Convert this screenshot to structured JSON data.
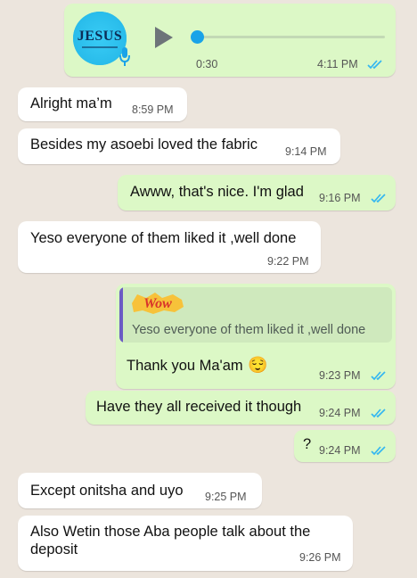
{
  "colors": {
    "chat_background": "#ece5dd",
    "incoming_bubble": "#ffffff",
    "outgoing_bubble": "#dcf8c6",
    "read_ticks": "#34b7f1",
    "voice_accent": "#1aa3e8",
    "quote_bar": "#6b5bc4"
  },
  "voice_note": {
    "avatar_text": "JESUS",
    "duration": "0:30",
    "time": "4:11 PM",
    "progress": 0,
    "play_icon": "play-icon",
    "mic_icon": "mic-icon"
  },
  "messages": [
    {
      "direction": "in",
      "text": "Alright ma’m",
      "time": "8:59 PM"
    },
    {
      "direction": "in",
      "text": "Besides my asoebi loved the fabric",
      "time": "9:14 PM"
    },
    {
      "direction": "out",
      "text": "Awww, that's nice. I'm glad",
      "time": "9:16 PM",
      "ticks": "read"
    },
    {
      "direction": "in",
      "text": "Yeso everyone of them liked it ,well done",
      "time": "9:22 PM"
    },
    {
      "direction": "out",
      "quote_sticker": "Wow",
      "quote_text": "Yeso everyone of them liked it ,well done",
      "text": "Thank you Ma'am",
      "emoji": "😌",
      "time": "9:23 PM",
      "ticks": "read"
    },
    {
      "direction": "out",
      "text": "Have they all received it though",
      "time": "9:24 PM",
      "ticks": "read"
    },
    {
      "direction": "out",
      "text": "?",
      "time": "9:24 PM",
      "ticks": "read"
    },
    {
      "direction": "in",
      "text": "Except onitsha and uyo",
      "time": "9:25 PM"
    },
    {
      "direction": "in",
      "text": "Also Wetin those Aba people talk about the deposit",
      "time": "9:26 PM"
    }
  ]
}
